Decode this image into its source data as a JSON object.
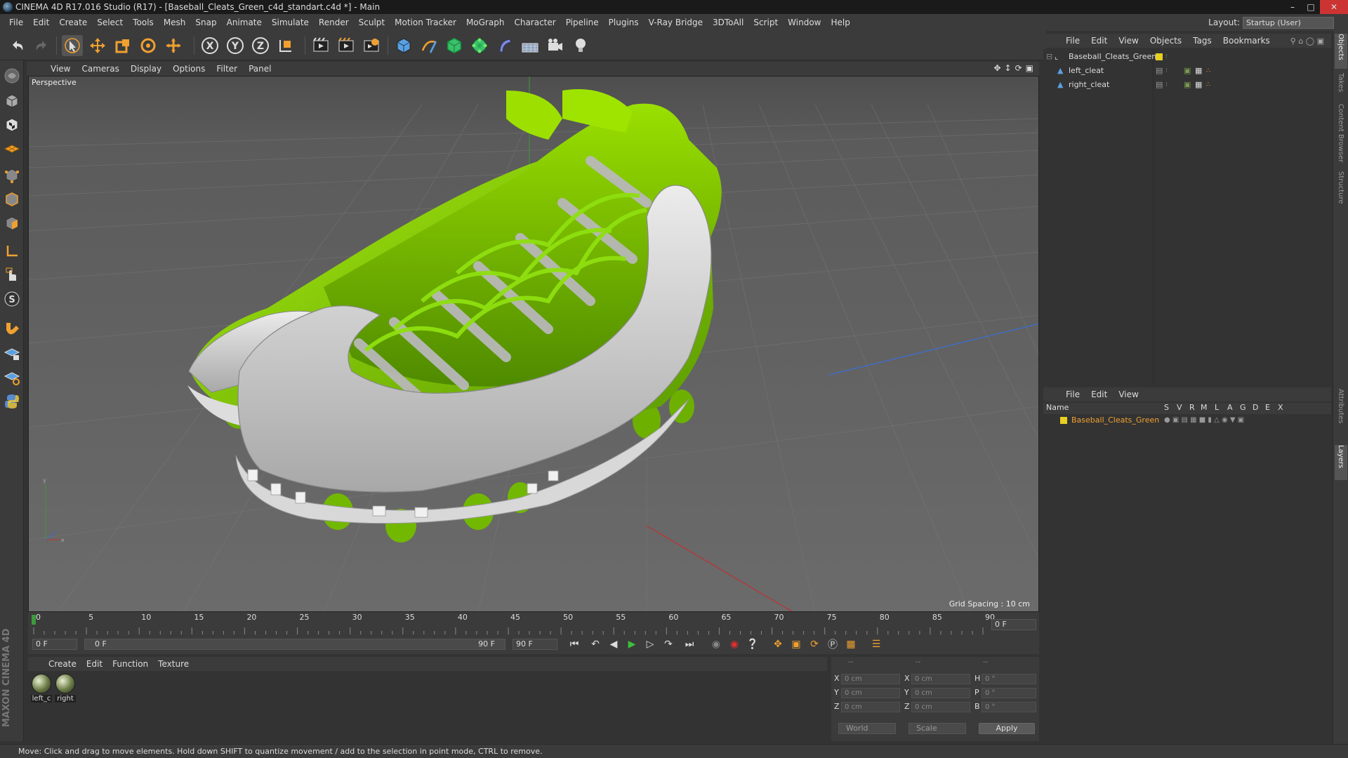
{
  "window": {
    "title": "CINEMA 4D R17.016 Studio (R17) - [Baseball_Cleats_Green_c4d_standart.c4d *] - Main"
  },
  "menu": [
    "File",
    "Edit",
    "Create",
    "Select",
    "Tools",
    "Mesh",
    "Snap",
    "Animate",
    "Simulate",
    "Render",
    "Sculpt",
    "Motion Tracker",
    "MoGraph",
    "Character",
    "Pipeline",
    "Plugins",
    "V-Ray Bridge",
    "3DToAll",
    "Script",
    "Window",
    "Help"
  ],
  "layout": {
    "label": "Layout:",
    "value": "Startup (User)"
  },
  "viewport": {
    "menu": [
      "View",
      "Cameras",
      "Display",
      "Options",
      "Filter",
      "Panel"
    ],
    "label": "Perspective",
    "grid_spacing": "Grid Spacing : 10 cm"
  },
  "timeline": {
    "ticks": [
      "0",
      "5",
      "10",
      "15",
      "20",
      "25",
      "30",
      "35",
      "40",
      "45",
      "50",
      "55",
      "60",
      "65",
      "70",
      "75",
      "80",
      "85",
      "90"
    ],
    "current_frame": "0 F",
    "start_field": "0 F",
    "range_start": "0 F",
    "range_end": "90 F",
    "end_field": "90 F"
  },
  "material_manager": {
    "menu": [
      "Create",
      "Edit",
      "Function",
      "Texture"
    ],
    "materials": [
      {
        "label": "left_c"
      },
      {
        "label": "right"
      }
    ]
  },
  "coordinates": {
    "header": [
      "--",
      "--",
      "--"
    ],
    "rows": [
      {
        "a": "X",
        "av": "0 cm",
        "b": "X",
        "bv": "0 cm",
        "c": "H",
        "cv": "0 °"
      },
      {
        "a": "Y",
        "av": "0 cm",
        "b": "Y",
        "bv": "0 cm",
        "c": "P",
        "cv": "0 °"
      },
      {
        "a": "Z",
        "av": "0 cm",
        "b": "Z",
        "bv": "0 cm",
        "c": "B",
        "cv": "0 °"
      }
    ],
    "space": "World",
    "mode": "Scale",
    "apply": "Apply"
  },
  "status": "Move: Click and drag to move elements. Hold down SHIFT to quantize movement / add to the selection in point mode, CTRL to remove.",
  "object_manager": {
    "menu": [
      "File",
      "Edit",
      "View",
      "Objects",
      "Tags",
      "Bookmarks"
    ],
    "objects": [
      {
        "name": "Baseball_Cleats_Green",
        "layer_color": "#e8d020"
      },
      {
        "name": "left_cleat"
      },
      {
        "name": "right_cleat"
      }
    ]
  },
  "layer_manager": {
    "menu": [
      "File",
      "Edit",
      "View"
    ],
    "columns": [
      "Name",
      "S",
      "V",
      "R",
      "M",
      "L",
      "A",
      "G",
      "D",
      "E",
      "X"
    ],
    "layers": [
      {
        "name": "Baseball_Cleats_Green",
        "color": "#e8d020"
      }
    ]
  },
  "right_tabs": [
    "Objects",
    "Takes",
    "Content Browser",
    "Structure",
    "Attributes",
    "Layers"
  ],
  "branding": {
    "logo": "MAXON CINEMA 4D"
  },
  "colors": {
    "accent_green": "#7dc800",
    "selection_orange": "#f0a030",
    "axis_blue": "#3a6fd8"
  }
}
